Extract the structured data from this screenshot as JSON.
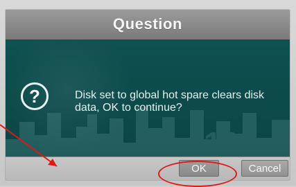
{
  "dialog": {
    "title": "Question",
    "message": "Disk set to global hot spare clears disk data, OK to continue?",
    "question_icon": "question-circle-icon"
  },
  "buttons": {
    "ok": "OK",
    "cancel": "Cancel"
  },
  "colors": {
    "dialog_bg": "#0e4b4b",
    "titlebar": "#8a8a8a",
    "button_bg": "#a0a0a0",
    "annotation": "#e01818"
  }
}
